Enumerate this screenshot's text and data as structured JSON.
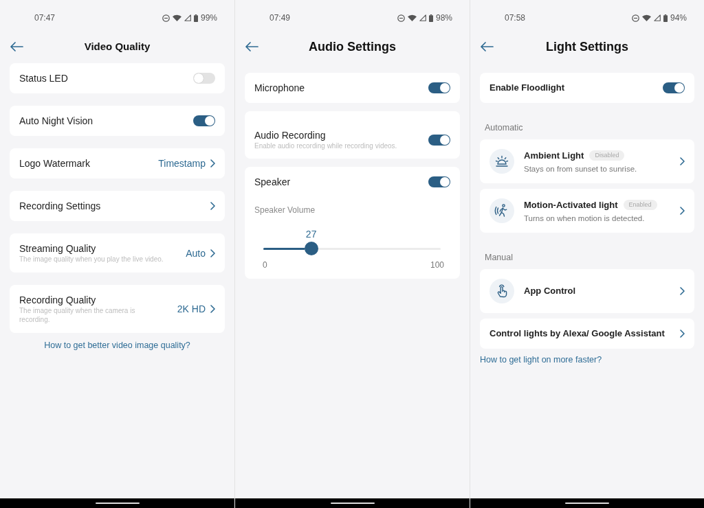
{
  "screens": [
    {
      "status_bar": {
        "time": "07:47",
        "battery": "99%"
      },
      "title": "Video Quality",
      "items": [
        {
          "kind": "toggle",
          "label": "Status LED",
          "on": false
        },
        {
          "kind": "toggle",
          "label": "Auto Night Vision",
          "on": true
        },
        {
          "kind": "nav",
          "label": "Logo Watermark",
          "value": "Timestamp"
        },
        {
          "kind": "nav",
          "label": "Recording Settings"
        },
        {
          "kind": "nav",
          "label": "Streaming Quality",
          "description": "The image quality when you play the live video.",
          "value": "Auto"
        },
        {
          "kind": "nav",
          "label": "Recording Quality",
          "description": "The image quality when the camera is recording.",
          "value": "2K HD"
        }
      ],
      "help_link": "How to get better video image quality?"
    },
    {
      "status_bar": {
        "time": "07:49",
        "battery": "98%"
      },
      "title": "Audio Settings",
      "items": [
        {
          "kind": "toggle",
          "label": "Microphone",
          "on": true
        },
        {
          "kind": "toggle",
          "label": "Audio Recording",
          "description": "Enable audio recording while recording videos.",
          "on": true
        },
        {
          "kind": "toggle",
          "label": "Speaker",
          "on": true,
          "slider": {
            "label": "Speaker Volume",
            "reading": "27",
            "level": 0.27,
            "min_label": "0",
            "max_label": "100"
          }
        }
      ]
    },
    {
      "status_bar": {
        "time": "07:58",
        "battery": "94%"
      },
      "title": "Light Settings",
      "items": [
        {
          "kind": "toggle",
          "label": "Enable Floodlight",
          "on": true
        },
        {
          "kind": "heading",
          "label": "Automatic"
        },
        {
          "kind": "mode",
          "label": "Ambient Light",
          "badge": "Disabled",
          "description": "Stays on from sunset to sunrise."
        },
        {
          "kind": "mode",
          "label": "Motion-Activated light",
          "badge": "Enabled",
          "description": "Turns on when motion is detected."
        },
        {
          "kind": "heading",
          "label": "Manual"
        },
        {
          "kind": "mode",
          "label": "App Control"
        },
        {
          "kind": "nav",
          "label": "Control lights by Alexa/ Google Assistant"
        }
      ],
      "help_link": "How to get light on more faster?"
    }
  ]
}
